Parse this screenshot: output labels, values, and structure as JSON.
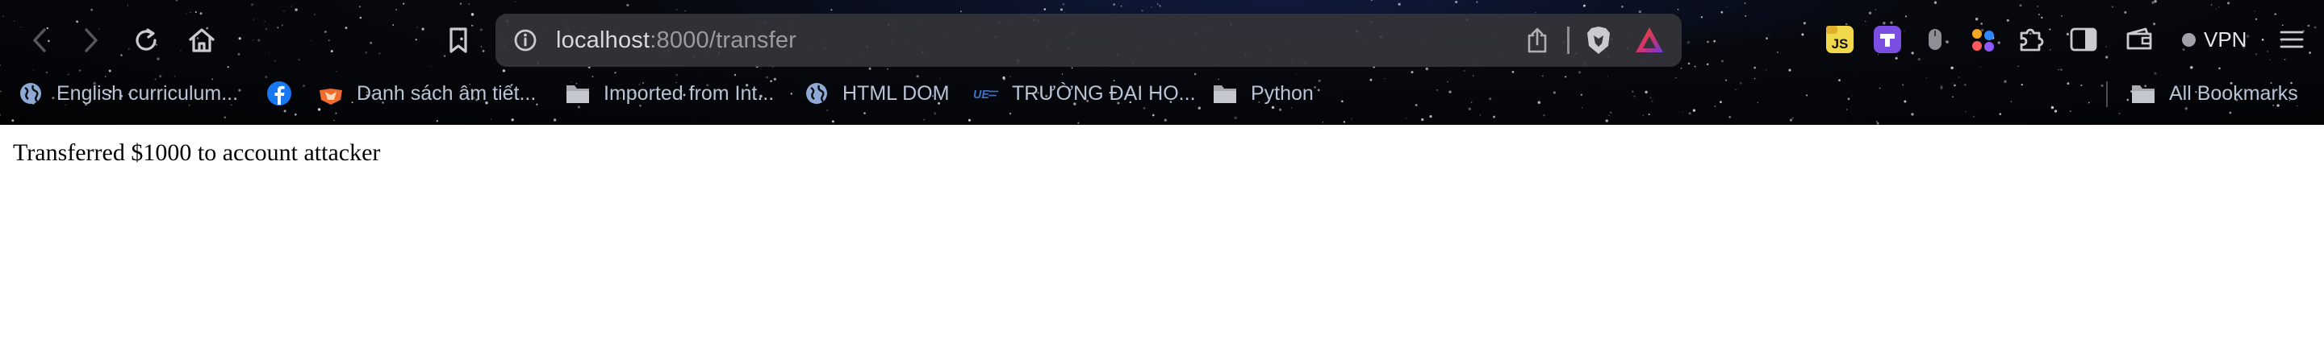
{
  "browser": {
    "address_bar": {
      "host": "localhost",
      "path": ":8000/transfer"
    },
    "nav_icons": [
      "back-icon",
      "forward-icon",
      "reload-icon",
      "home-icon",
      "bookmark-icon"
    ],
    "extensions": [
      "js-extension-icon",
      "purple-extension-icon",
      "mouse-extension-icon",
      "dots-extension-icon",
      "puzzle-extensions-icon",
      "sidebar-icon",
      "wallet-icon"
    ],
    "vpn_label": "VPN",
    "bookmarks": [
      {
        "label": "English curriculum...",
        "icon": "globe-icon"
      },
      {
        "label": "",
        "icon": "facebook-icon"
      },
      {
        "label": "Danh sách âm tiết...",
        "icon": "lotus-icon"
      },
      {
        "label": "Imported from Int...",
        "icon": "folder-icon"
      },
      {
        "label": "HTML DOM",
        "icon": "globe-icon"
      },
      {
        "label": "TRƯỜNG ĐẠI HỌ...",
        "icon": "ue-logo-icon"
      },
      {
        "label": "Python",
        "icon": "folder-icon"
      }
    ],
    "all_bookmarks_label": "All Bookmarks"
  },
  "page": {
    "message": "Transferred $1000 to account attacker"
  },
  "colors": {
    "toolbar_bg": "#05060a",
    "omnibox_bg": "#34343a",
    "brave_orange": "#fb542b",
    "facebook_blue": "#1877f2",
    "js_yellow": "#f2d84b",
    "purple_ext": "#7b4de0"
  }
}
